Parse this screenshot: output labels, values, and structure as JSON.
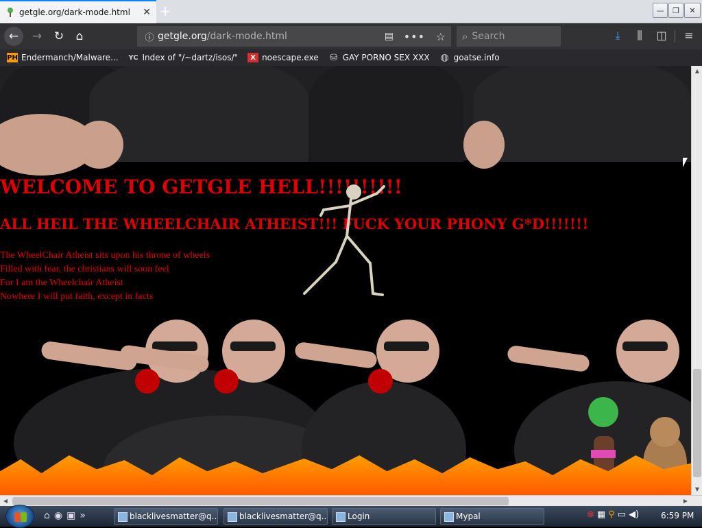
{
  "tab": {
    "title": "getgle.org/dark-mode.html",
    "close": "✕",
    "new_tab": "+"
  },
  "window_controls": {
    "minimize": "—",
    "maximize": "❐",
    "close": "✕"
  },
  "url": {
    "host": "getgle.org",
    "path": "/dark-mode.html"
  },
  "search": {
    "placeholder": "Search"
  },
  "bookmarks": [
    {
      "label": "Endermanch/Malware...",
      "icon": "PH"
    },
    {
      "label": "Index of \"/~dartz/isos/\"",
      "icon": "YC"
    },
    {
      "label": "noescape.exe",
      "icon": "X"
    },
    {
      "label": "GAY PORNO SEX XXX",
      "icon": "disk"
    },
    {
      "label": "goatse.info",
      "icon": "globe"
    }
  ],
  "page": {
    "heading": "WELCOME TO GETGLE HELL!!!!!!!!!!",
    "subheading": "ALL HEIL THE WHEELCHAIR ATHEIST!!! FUCK YOUR PHONY G*D!!!!!!!",
    "poem": [
      "The WheelChair Atheist sits upon his throne of wheels",
      "Filled with fear, the christians will soon feel",
      "For I am the Wheelchair Atheist",
      "Nowhere I will put faith, except in facts"
    ]
  },
  "taskbar": {
    "tasks": [
      "blacklivesmatter@q...",
      "blacklivesmatter@q...",
      "Login",
      "Mypal"
    ],
    "clock": "6:59 PM"
  },
  "colors": {
    "heading": "#dd0000",
    "tab_accent": "#0a84ff",
    "download": "#45a1ff"
  }
}
